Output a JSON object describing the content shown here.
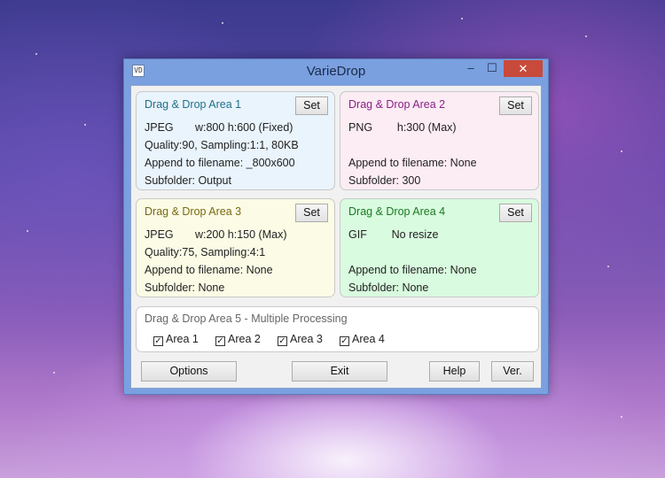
{
  "window": {
    "title": "VarieDrop",
    "icon_name": "app-icon",
    "icon_glyph": "VD",
    "minimize_glyph": "–",
    "maximize_glyph": "☐",
    "close_glyph": "✕"
  },
  "areas": [
    {
      "title": "Drag & Drop Area 1",
      "set_label": "Set",
      "line1": "JPEG       w:800 h:600 (Fixed)",
      "line2": "Quality:90, Sampling:1:1, 80KB",
      "line3": "Append to filename: _800x600",
      "line4": "Subfolder: Output"
    },
    {
      "title": "Drag & Drop Area 2",
      "set_label": "Set",
      "line1": "PNG        h:300 (Max)",
      "line2": "",
      "line3": "Append to filename: None",
      "line4": "Subfolder: 300"
    },
    {
      "title": "Drag & Drop Area 3",
      "set_label": "Set",
      "line1": "JPEG       w:200 h:150 (Max)",
      "line2": "Quality:75, Sampling:4:1",
      "line3": "Append to filename: None",
      "line4": "Subfolder: None"
    },
    {
      "title": "Drag & Drop Area 4",
      "set_label": "Set",
      "line1": "GIF        No resize",
      "line2": "",
      "line3": "Append to filename: None",
      "line4": "Subfolder: None"
    }
  ],
  "area5": {
    "title": "Drag & Drop Area 5 - Multiple Processing",
    "checkboxes": [
      {
        "label": "Area 1",
        "checked": true,
        "mark": "✓"
      },
      {
        "label": "Area 2",
        "checked": true,
        "mark": "✓"
      },
      {
        "label": "Area 3",
        "checked": true,
        "mark": "✓"
      },
      {
        "label": "Area 4",
        "checked": true,
        "mark": "✓"
      }
    ]
  },
  "buttons": {
    "options": "Options",
    "exit": "Exit",
    "help": "Help",
    "ver": "Ver."
  },
  "colors": {
    "close_button": "#c84a3a",
    "area1_bg": "#eaf4fc",
    "area2_bg": "#fcecf3",
    "area3_bg": "#fbfbe6",
    "area4_bg": "#d9fbdf"
  }
}
